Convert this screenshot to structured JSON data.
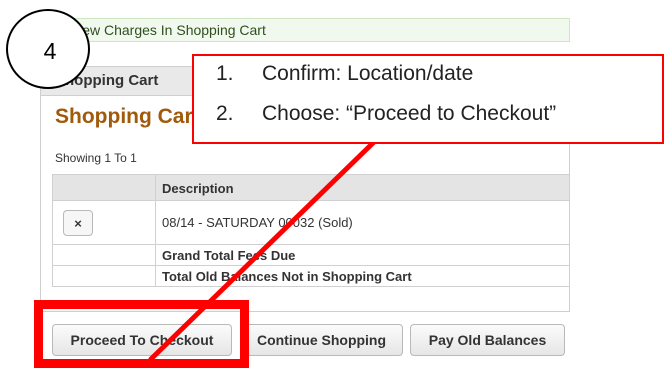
{
  "notice": {
    "text": "View Charges In Shopping Cart"
  },
  "annotation": {
    "step_number": "4",
    "callout_lines": [
      {
        "num": "1.",
        "text": "Confirm: Location/date"
      },
      {
        "num": "2.",
        "text": "Choose: “Proceed to Checkout”"
      }
    ],
    "highlight_color": "#ff0000"
  },
  "panel": {
    "header": "Shopping Cart",
    "title": "Shopping Cart",
    "showing": "Showing 1 To 1"
  },
  "table": {
    "header_col2": "Description",
    "rows": {
      "item": {
        "remove_icon": "close-icon",
        "remove_symbol": "×",
        "description": "08/14 - SATURDAY 00032 (Sold)"
      },
      "grand_total": {
        "label": "Grand Total Fees Due"
      },
      "old_balances": {
        "label": "Total Old Balances Not in Shopping Cart"
      }
    }
  },
  "buttons": {
    "proceed": "Proceed To Checkout",
    "continue": "Continue Shopping",
    "pay_old": "Pay Old Balances"
  },
  "colors": {
    "accent_title": "#a05a0a",
    "annotation_red": "#ff0000",
    "notice_bg": "#f1f9ee"
  }
}
